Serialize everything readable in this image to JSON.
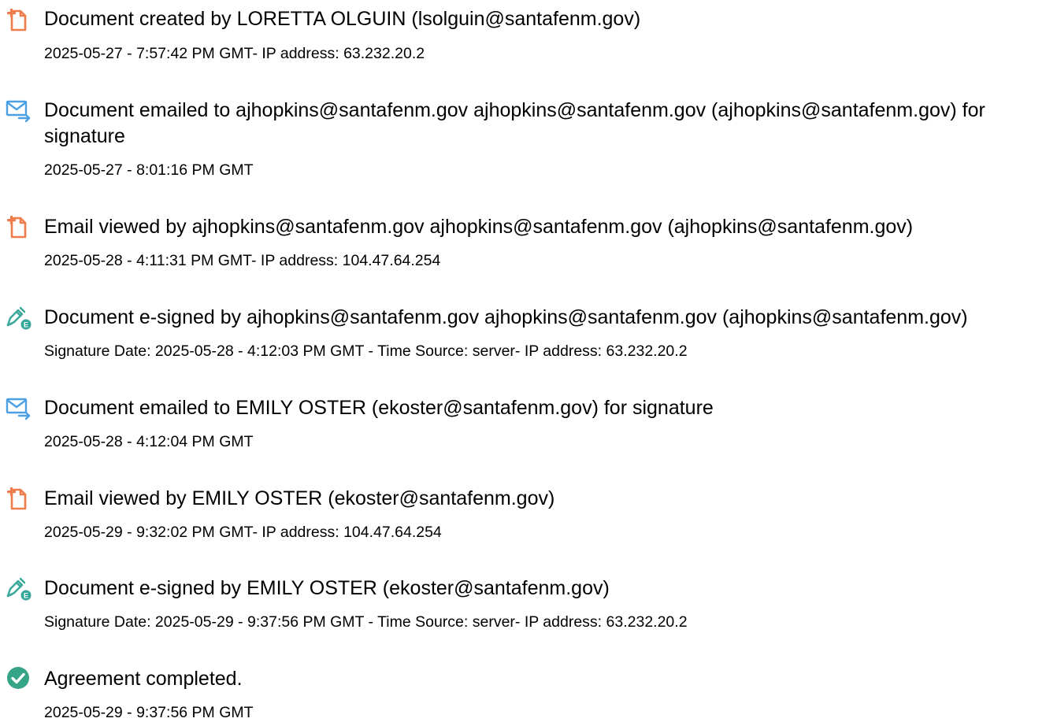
{
  "colors": {
    "created_icon": "#EE7D4B",
    "emailed_icon": "#4A9FE5",
    "viewed_icon": "#EE7D4B",
    "signed_icon": "#37A899",
    "completed_icon": "#35A487",
    "text": "#000000"
  },
  "events": [
    {
      "icon": "document-created-icon",
      "title": "Document created by LORETTA OLGUIN (lsolguin@santafenm.gov)",
      "meta": "2025-05-27 - 7:57:42 PM GMT- IP address: 63.232.20.2"
    },
    {
      "icon": "email-sent-icon",
      "title": "Document emailed to ajhopkins@santafenm.gov ajhopkins@santafenm.gov (ajhopkins@santafenm.gov) for signature",
      "meta": "2025-05-27 - 8:01:16 PM GMT"
    },
    {
      "icon": "email-viewed-icon",
      "title": "Email viewed by ajhopkins@santafenm.gov ajhopkins@santafenm.gov (ajhopkins@santafenm.gov)",
      "meta": "2025-05-28 - 4:11:31 PM GMT- IP address: 104.47.64.254"
    },
    {
      "icon": "e-sign-pen-icon",
      "title": "Document e-signed by ajhopkins@santafenm.gov ajhopkins@santafenm.gov (ajhopkins@santafenm.gov)",
      "meta": "Signature Date: 2025-05-28 - 4:12:03 PM GMT - Time Source: server- IP address: 63.232.20.2"
    },
    {
      "icon": "email-sent-icon",
      "title": "Document emailed to EMILY OSTER (ekoster@santafenm.gov) for signature",
      "meta": "2025-05-28 - 4:12:04 PM GMT"
    },
    {
      "icon": "email-viewed-icon",
      "title": "Email viewed by EMILY OSTER (ekoster@santafenm.gov)",
      "meta": "2025-05-29 - 9:32:02 PM GMT- IP address: 104.47.64.254"
    },
    {
      "icon": "e-sign-pen-icon",
      "title": "Document e-signed by EMILY OSTER (ekoster@santafenm.gov)",
      "meta": "Signature Date: 2025-05-29 - 9:37:56 PM GMT - Time Source: server- IP address: 63.232.20.2"
    },
    {
      "icon": "agreement-completed-icon",
      "title": "Agreement completed.",
      "meta": "2025-05-29 - 9:37:56 PM GMT"
    }
  ]
}
